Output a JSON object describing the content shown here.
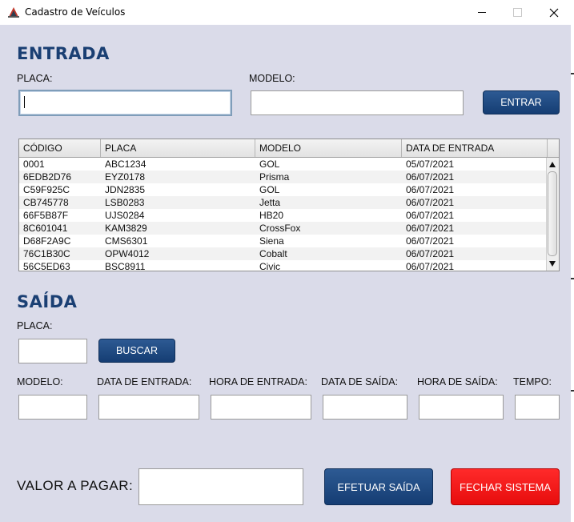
{
  "window": {
    "title": "Cadastro de Veículos"
  },
  "entrada": {
    "heading": "ENTRADA",
    "placa_label": "PLACA:",
    "placa_value": "",
    "modelo_label": "MODELO:",
    "modelo_value": "",
    "entrar_button": "ENTRAR"
  },
  "table": {
    "columns": [
      "CÓDIGO",
      "PLACA",
      "MODELO",
      "DATA DE ENTRADA"
    ],
    "rows": [
      [
        "0001",
        "ABC1234",
        "GOL",
        "05/07/2021"
      ],
      [
        "6EDB2D76",
        "EYZ0178",
        "Prisma",
        "06/07/2021"
      ],
      [
        "C59F925C",
        "JDN2835",
        "GOL",
        "06/07/2021"
      ],
      [
        "CB745778",
        "LSB0283",
        "Jetta",
        "06/07/2021"
      ],
      [
        "66F5B87F",
        "UJS0284",
        "HB20",
        "06/07/2021"
      ],
      [
        "8C601041",
        "KAM3829",
        "CrossFox",
        "06/07/2021"
      ],
      [
        "D68F2A9C",
        "CMS6301",
        "Siena",
        "06/07/2021"
      ],
      [
        "76C1B30C",
        "OPW4012",
        "Cobalt",
        "06/07/2021"
      ],
      [
        "56C5ED63",
        "BSC8911",
        "Civic",
        "06/07/2021"
      ]
    ]
  },
  "saida": {
    "heading": "SAÍDA",
    "placa_label": "PLACA:",
    "buscar_button": "BUSCAR",
    "modelo_label": "MODELO:",
    "data_entrada_label": "DATA DE ENTRADA:",
    "hora_entrada_label": "HORA DE ENTRADA:",
    "data_saida_label": "DATA DE SAÍDA:",
    "hora_saida_label": "HORA DE SAÍDA:",
    "tempo_label": "TEMPO:"
  },
  "footer": {
    "valor_label": "VALOR A PAGAR:",
    "efetuar_button": "EFETUAR SAÍDA",
    "fechar_button": "FECHAR SISTEMA"
  },
  "colors": {
    "accent": "#1a3f73",
    "button_blue": "#153d73",
    "button_red": "#f01414",
    "background": "#dadbe9"
  }
}
